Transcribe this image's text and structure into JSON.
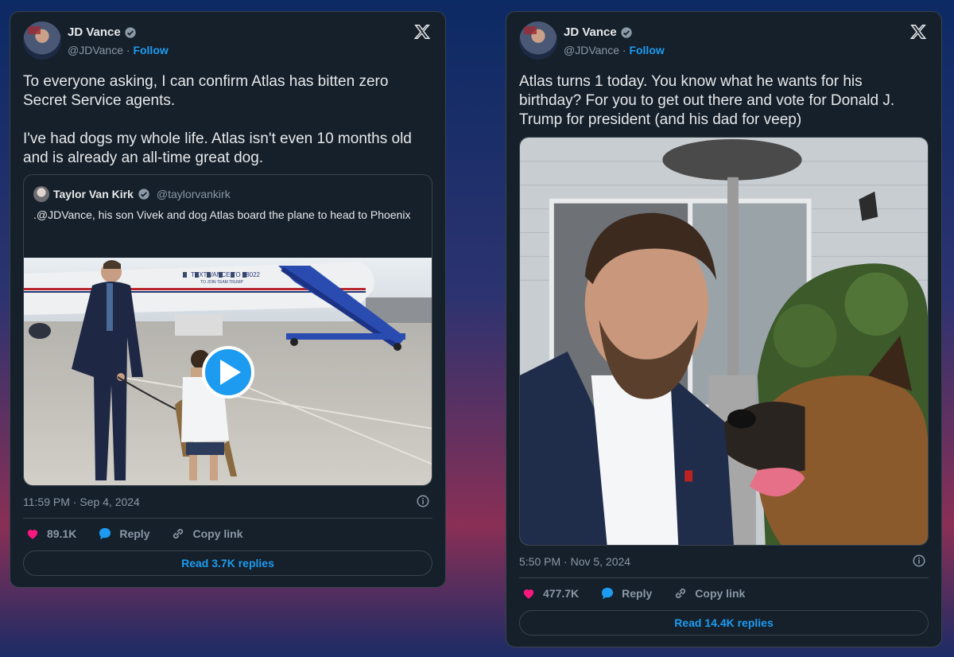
{
  "tweets": [
    {
      "author": "JD Vance",
      "handle": "@JDVance",
      "separator": "·",
      "follow_label": "Follow",
      "text_paragraphs": [
        "To everyone asking, I can confirm Atlas has bitten zero Secret Service agents.",
        "I've had dogs my whole life. Atlas isn't even 10 months old and is already an all-time great dog."
      ],
      "quote": {
        "author": "Taylor Van Kirk",
        "handle": "@taylorvankirk",
        "text": ".@JDVance, his son Vivek and dog Atlas board the plane to head to Phoenix",
        "media": {
          "plane_text": "TEXT VANCE TO 88022",
          "plane_subtext": "TO JOIN TEAM TRUMP",
          "type": "video"
        }
      },
      "timestamp": "11:59 PM · Sep 4, 2024",
      "likes": "89.1K",
      "reply_label": "Reply",
      "copy_link_label": "Copy link",
      "read_replies": "Read 3.7K replies"
    },
    {
      "author": "JD Vance",
      "handle": "@JDVance",
      "separator": "·",
      "follow_label": "Follow",
      "text": "Atlas turns 1 today. You know what he wants for his birthday? For you to get out there and vote for Donald J. Trump for president (and his dad for veep)",
      "timestamp": "5:50 PM · Nov 5, 2024",
      "likes": "477.7K",
      "reply_label": "Reply",
      "copy_link_label": "Copy link",
      "read_replies": "Read 14.4K replies"
    }
  ],
  "colors": {
    "accent": "#1d9bf0",
    "like": "#f91880",
    "card_bg": "#15202b",
    "border": "#38444d",
    "muted": "#8b98a5"
  },
  "icons": [
    "verified-badge-icon",
    "x-logo-icon",
    "play-icon",
    "info-icon",
    "heart-icon",
    "reply-bubble-icon",
    "link-icon"
  ]
}
